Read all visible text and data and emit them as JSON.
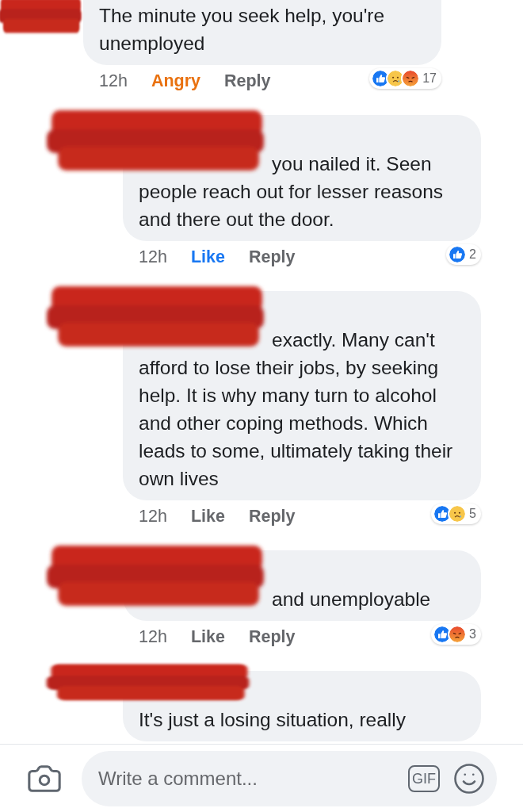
{
  "comments": [
    {
      "kind": "name-hidden",
      "redacted": true,
      "text": "The minute you seek help, you're unemployed",
      "time": "12h",
      "reaction_label": {
        "text": "Angry",
        "color": "#e9710f"
      },
      "reply": "Reply",
      "reactions": [
        {
          "kind": "like"
        },
        {
          "kind": "sad"
        },
        {
          "kind": "angry"
        }
      ],
      "reaction_count": "17",
      "children": [
        {
          "kind": "name-inline",
          "redacted": true,
          "text": "you nailed it. Seen people reach out for lesser reasons and there out the door.",
          "time": "12h",
          "reaction_label": {
            "text": "Like",
            "color": "#1877f2"
          },
          "reply": "Reply",
          "reactions": [
            {
              "kind": "like"
            }
          ],
          "reaction_count": "2"
        },
        {
          "kind": "name-inline",
          "redacted": true,
          "text": "exactly. Many can't afford to lose their jobs, by seeking help. It is why many turn to alcohol and other coping methods. Which leads to some, ultimately taking their own lives",
          "time": "12h",
          "reaction_label": {
            "text": "Like",
            "color": "#65676b"
          },
          "reply": "Reply",
          "reactions": [
            {
              "kind": "like"
            },
            {
              "kind": "sad"
            }
          ],
          "reaction_count": "5"
        },
        {
          "kind": "name-inline",
          "redacted": true,
          "text": "and unemployable",
          "time": "12h",
          "reaction_label": {
            "text": "Like",
            "color": "#65676b"
          },
          "reply": "Reply",
          "reactions": [
            {
              "kind": "like"
            },
            {
              "kind": "angry"
            }
          ],
          "reaction_count": "3"
        },
        {
          "kind": "name-above",
          "redacted": true,
          "text": "It's just a losing situation, really"
        }
      ]
    }
  ],
  "composer": {
    "placeholder": "Write a comment...",
    "gif_label": "GIF"
  }
}
